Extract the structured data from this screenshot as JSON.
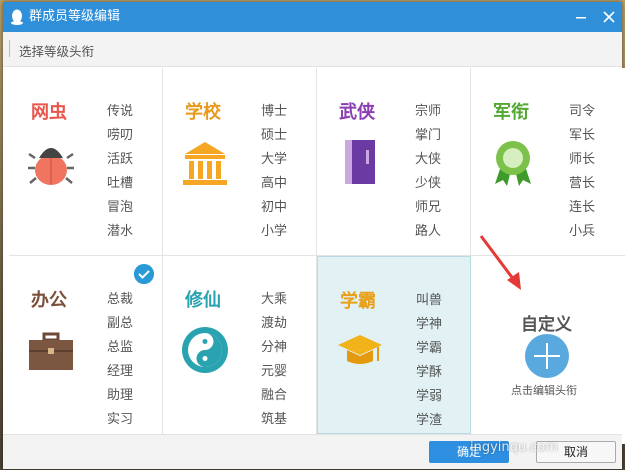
{
  "window": {
    "title": "群成员等级编辑"
  },
  "toolbar": {
    "subtitle": "选择等级头衔"
  },
  "categories": [
    {
      "name": "网虫",
      "color": "#e8564e",
      "icon": "bug-icon",
      "items": [
        "传说",
        "唠叨",
        "活跃",
        "吐槽",
        "冒泡",
        "潜水"
      ]
    },
    {
      "name": "学校",
      "color": "#e89a1e",
      "icon": "school-building-icon",
      "items": [
        "博士",
        "硕士",
        "大学",
        "高中",
        "初中",
        "小学"
      ]
    },
    {
      "name": "武侠",
      "color": "#8b3fb1",
      "icon": "martial-book-icon",
      "items": [
        "宗师",
        "掌门",
        "大侠",
        "少侠",
        "师兄",
        "路人"
      ]
    },
    {
      "name": "军衔",
      "color": "#52a832",
      "icon": "medal-icon",
      "items": [
        "司令",
        "军长",
        "师长",
        "营长",
        "连长",
        "小兵"
      ]
    },
    {
      "name": "办公",
      "color": "#7b4f3a",
      "icon": "briefcase-icon",
      "items": [
        "总裁",
        "副总",
        "总监",
        "经理",
        "助理",
        "实习"
      ]
    },
    {
      "name": "修仙",
      "color": "#2aa3b0",
      "icon": "yin-yang-icon",
      "items": [
        "大乘",
        "渡劫",
        "分神",
        "元婴",
        "融合",
        "筑基"
      ]
    },
    {
      "name": "学霸",
      "color": "#e8a01a",
      "icon": "graduation-cap-icon",
      "items": [
        "叫兽",
        "学神",
        "学霸",
        "学酥",
        "学弱",
        "学渣"
      ]
    }
  ],
  "custom": {
    "title": "自定义",
    "subtitle": "点击编辑头衔"
  },
  "buttons": {
    "ok": "确定",
    "cancel": "取消"
  },
  "watermark": "ingyinqu.com"
}
